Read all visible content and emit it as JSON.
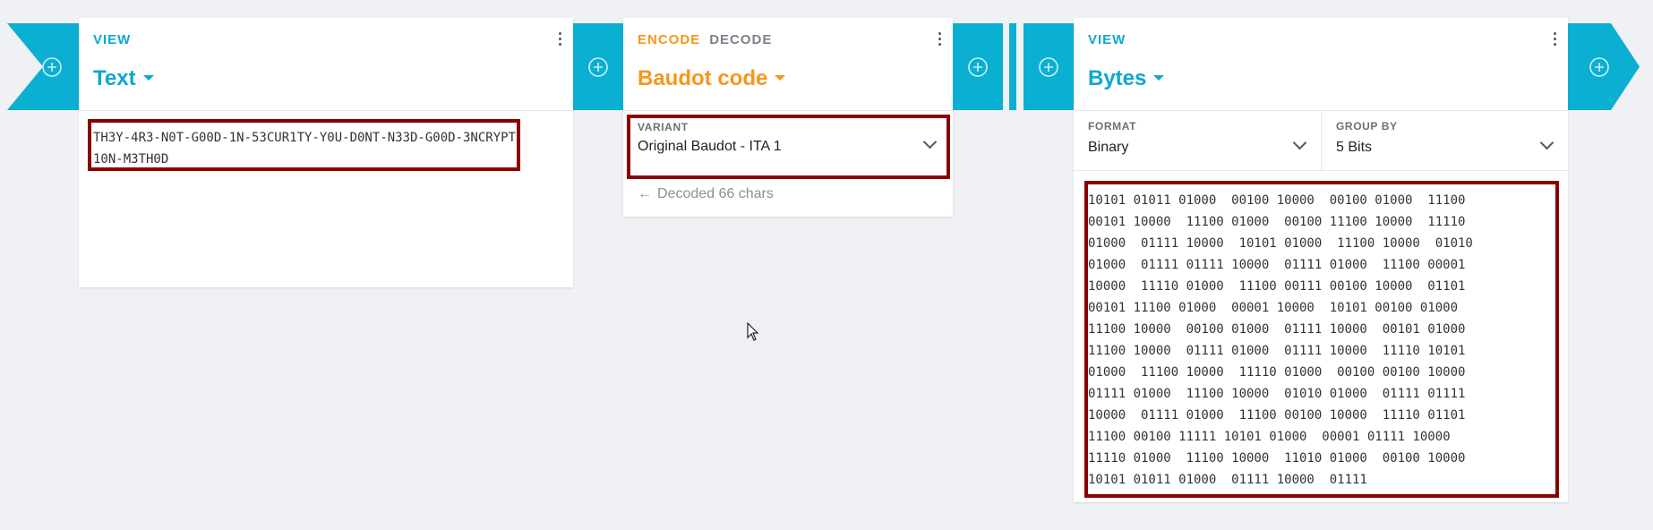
{
  "colors": {
    "accent": "#0bafd1",
    "encode": "#f4971c",
    "highlight": "#8b0000",
    "background": "#eff1f4"
  },
  "icons": {
    "add": "plus-circle-icon",
    "menu": "kebab-menu-icon",
    "back": "arrow-left-icon",
    "dropdown": "chevron-down-icon"
  },
  "text_view": {
    "tab": "VIEW",
    "title": "Text",
    "content": "TH3Y-4R3-N0T-G00D-1N-53CUR1TY-Y0U-D0NT-N33D-G00D-3NCRYPT10N-M3TH0D"
  },
  "codec": {
    "tab_encode": "ENCODE",
    "tab_decode": "DECODE",
    "title": "Baudot code",
    "variant_label": "VARIANT",
    "variant_value": "Original Baudot - ITA 1",
    "status": "Decoded 66 chars"
  },
  "bytes_view": {
    "tab": "VIEW",
    "title": "Bytes",
    "format_label": "FORMAT",
    "format_value": "Binary",
    "group_label": "GROUP BY",
    "group_value": "5 Bits",
    "lines": [
      "10101 01011 01000  00100 10000  00100 01000  11100",
      "00101 10000  11100 01000  00100 11100 10000  11110",
      "01000  01111 10000  10101 01000  11100 10000  01010",
      "01000  01111 01111 10000  01111 01000  11100 00001",
      "10000  11110 01000  11100 00111 00100 10000  01101",
      "00101 11100 01000  00001 10000  10101 00100 01000",
      "11100 10000  00100 01000  01111 10000  00101 01000",
      "11100 10000  01111 01000  01111 10000  11110 10101",
      "01000  11100 10000  11110 01000  00100 00100 10000",
      "01111 01000  11100 10000  01010 01000  01111 01111",
      "10000  01111 01000  11100 00100 10000  11110 01101",
      "11100 00100 11111 10101 01000  00001 01111 10000",
      "11110 01000  11100 10000  11010 01000  00100 10000",
      "10101 01011 01000  01111 10000  01111"
    ]
  }
}
